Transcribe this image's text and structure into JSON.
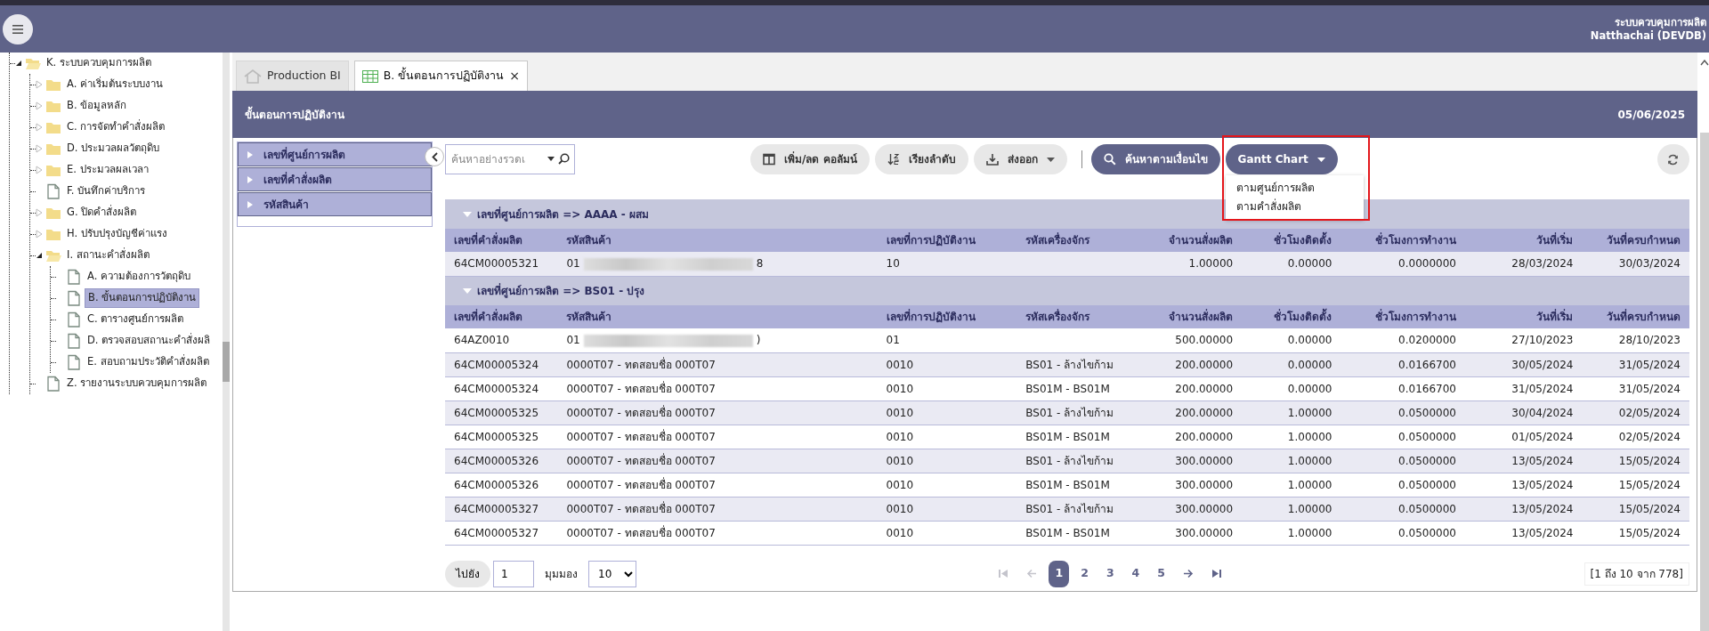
{
  "header": {
    "app_title": "ระบบควบคุมการผลิต",
    "user": "Natthachai (DEVDB)"
  },
  "tree": [
    {
      "label": "K. ระบบควบคุมการผลิต",
      "kind": "folder",
      "expanded": true,
      "selected": false,
      "children": [
        {
          "label": "A. ค่าเริ่มต้นระบบงาน",
          "kind": "folder",
          "expanded": false,
          "selected": false
        },
        {
          "label": "B. ข้อมูลหลัก",
          "kind": "folder",
          "expanded": false,
          "selected": false
        },
        {
          "label": "C. การจัดทำคำสั่งผลิต",
          "kind": "folder",
          "expanded": false,
          "selected": false
        },
        {
          "label": "D. ประมวลผลวัตถุดิบ",
          "kind": "folder",
          "expanded": false,
          "selected": false
        },
        {
          "label": "E. ประมวลผลเวลา",
          "kind": "folder",
          "expanded": false,
          "selected": false
        },
        {
          "label": "F. บันทึกค่าบริการ",
          "kind": "file",
          "selected": false
        },
        {
          "label": "G. ปิดคำสั่งผลิต",
          "kind": "folder",
          "expanded": false,
          "selected": false
        },
        {
          "label": "H. ปรับปรุงบัญชีค่าแรง",
          "kind": "folder",
          "expanded": false,
          "selected": false
        },
        {
          "label": "I. สถานะคำสั่งผลิต",
          "kind": "folder",
          "expanded": true,
          "selected": false,
          "children": [
            {
              "label": "A. ความต้องการวัตถุดิบ",
              "kind": "file",
              "selected": false
            },
            {
              "label": "B. ขั้นตอนการปฏิบัติงาน",
              "kind": "file",
              "selected": true
            },
            {
              "label": "C. ตารางศูนย์การผลิต",
              "kind": "file",
              "selected": false
            },
            {
              "label": "D. ตรวจสอบสถานะคำสั่งผลิ",
              "kind": "file",
              "selected": false
            },
            {
              "label": "E. สอบถามประวัติคำสั่งผลิต",
              "kind": "file",
              "selected": false
            }
          ]
        },
        {
          "label": "Z. รายงานระบบควบคุมการผลิต",
          "kind": "file",
          "selected": false
        }
      ]
    }
  ],
  "tabs": [
    {
      "label": "Production BI",
      "kind": "home",
      "selected": false
    },
    {
      "label": "B. ขั้นตอนการปฏิบัติงาน",
      "kind": "grid",
      "selected": true,
      "close": "×"
    }
  ],
  "panel": {
    "title": "ขั้นตอนการปฏิบัติงาน",
    "date": "05/06/2025"
  },
  "filters": [
    {
      "label": "เลขที่ศูนย์การผลิต",
      "expanded": false
    },
    {
      "label": "เลขที่คำสั่งผลิต",
      "expanded": false
    },
    {
      "label": "รหัสสินค้า",
      "expanded": false
    }
  ],
  "search": {
    "placeholder": "ค้นหาอย่างรวดเ"
  },
  "toolbar": [
    {
      "label": "เพิ่ม/ลด คอลัมน์",
      "kind": "columns",
      "primary": false,
      "caret": false
    },
    {
      "label": "เรียงลำดับ",
      "kind": "sort",
      "primary": false,
      "caret": false
    },
    {
      "label": "ส่งออก",
      "kind": "download",
      "primary": false,
      "caret": true
    },
    {
      "label": "ค้นหาตามเงื่อนไข",
      "kind": "search",
      "primary": true,
      "caret": false
    },
    {
      "label": "Gantt Chart",
      "kind": "none",
      "primary": true,
      "caret": true,
      "highlighted": true,
      "menu": [
        "ตามศูนย์การผลิต",
        "ตามคำสั่งผลิต"
      ]
    }
  ],
  "table": {
    "groups": [
      {
        "title": "เลขที่ศูนย์การผลิต => AAAA - ผสม",
        "expanded": true,
        "columns": [
          "เลขที่คำสั่งผลิต",
          "รหัสสินค้า",
          "เลขที่การปฏิบัติงาน",
          "รหัสเครื่องจักร",
          "จำนวนสั่งผลิต",
          "ชั่วโมงติดตั้ง",
          "ชั่วโมงการทำงาน",
          "วันที่เริ่ม",
          "วันที่ครบกำหนด"
        ],
        "rows": [
          {
            "cells": [
              "64CM00005321",
              {
                "prefix": "01",
                "suffix": "8",
                "redacted": true
              },
              "10",
              "",
              "1.00000",
              "0.00000",
              "0.0000000",
              "28/03/2024",
              "30/03/2024"
            ]
          }
        ]
      },
      {
        "title": "เลขที่ศูนย์การผลิต => BS01 - ปรุง",
        "expanded": true,
        "columns": [
          "เลขที่คำสั่งผลิต",
          "รหัสสินค้า",
          "เลขที่การปฏิบัติงาน",
          "รหัสเครื่องจักร",
          "จำนวนสั่งผลิต",
          "ชั่วโมงติดตั้ง",
          "ชั่วโมงการทำงาน",
          "วันที่เริ่ม",
          "วันที่ครบกำหนด"
        ],
        "rows": [
          {
            "cells": [
              "64AZ0010",
              {
                "prefix": "01",
                "suffix": ")",
                "redacted": true
              },
              "01",
              "",
              "500.00000",
              "0.00000",
              "0.0200000",
              "27/10/2023",
              "28/10/2023"
            ]
          },
          {
            "cells": [
              "64CM00005324",
              "0000T07 - ทดสอบชื่อ 000T07",
              "0010",
              "BS01 - ล้างไขก้าม",
              "200.00000",
              "0.00000",
              "0.0166700",
              "30/05/2024",
              "31/05/2024"
            ]
          },
          {
            "cells": [
              "64CM00005324",
              "0000T07 - ทดสอบชื่อ 000T07",
              "0010",
              "BS01M - BS01M",
              "200.00000",
              "0.00000",
              "0.0166700",
              "31/05/2024",
              "31/05/2024"
            ]
          },
          {
            "cells": [
              "64CM00005325",
              "0000T07 - ทดสอบชื่อ 000T07",
              "0010",
              "BS01 - ล้างไขก้าม",
              "200.00000",
              "1.00000",
              "0.0500000",
              "30/04/2024",
              "02/05/2024"
            ]
          },
          {
            "cells": [
              "64CM00005325",
              "0000T07 - ทดสอบชื่อ 000T07",
              "0010",
              "BS01M - BS01M",
              "200.00000",
              "1.00000",
              "0.0500000",
              "01/05/2024",
              "02/05/2024"
            ]
          },
          {
            "cells": [
              "64CM00005326",
              "0000T07 - ทดสอบชื่อ 000T07",
              "0010",
              "BS01 - ล้างไขก้าม",
              "300.00000",
              "1.00000",
              "0.0500000",
              "13/05/2024",
              "15/05/2024"
            ]
          },
          {
            "cells": [
              "64CM00005326",
              "0000T07 - ทดสอบชื่อ 000T07",
              "0010",
              "BS01M - BS01M",
              "300.00000",
              "1.00000",
              "0.0500000",
              "13/05/2024",
              "15/05/2024"
            ]
          },
          {
            "cells": [
              "64CM00005327",
              "0000T07 - ทดสอบชื่อ 000T07",
              "0010",
              "BS01 - ล้างไขก้าม",
              "300.00000",
              "1.00000",
              "0.0500000",
              "13/05/2024",
              "15/05/2024"
            ]
          },
          {
            "cells": [
              "64CM00005327",
              "0000T07 - ทดสอบชื่อ 000T07",
              "0010",
              "BS01M - BS01M",
              "300.00000",
              "1.00000",
              "0.0500000",
              "13/05/2024",
              "15/05/2024"
            ]
          }
        ]
      }
    ]
  },
  "pagination": {
    "goto_label": "ไปยัง",
    "page_value": "1",
    "view_label": "มุมมอง",
    "page_size": "10",
    "pages": [
      {
        "label": "1",
        "selected": true
      },
      {
        "label": "2",
        "selected": false
      },
      {
        "label": "3",
        "selected": false
      },
      {
        "label": "4",
        "selected": false
      },
      {
        "label": "5",
        "selected": false
      }
    ],
    "range": "[1 ถึง 10 จาก 778]"
  }
}
